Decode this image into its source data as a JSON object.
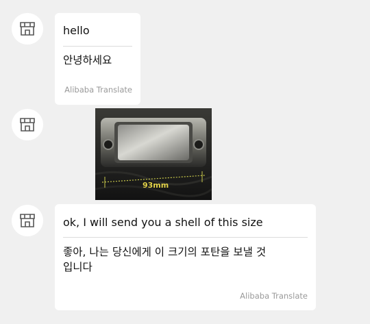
{
  "messages": [
    {
      "type": "text",
      "original": "hello",
      "translation": "안녕하세요",
      "attribution": "Alibaba Translate"
    },
    {
      "type": "image",
      "image_label": "93mm"
    },
    {
      "type": "text",
      "original": "ok, I will send you a shell of this size",
      "translation": "좋아, 나는 당신에게 이 크기의 포탄을 보낼 것입니다",
      "attribution": "Alibaba Translate"
    }
  ],
  "icons": {
    "avatar": "shop-icon"
  },
  "colors": {
    "background": "#f0f0f0",
    "bubble": "#ffffff",
    "attribution": "#999999",
    "divider": "#dcdcdc"
  }
}
